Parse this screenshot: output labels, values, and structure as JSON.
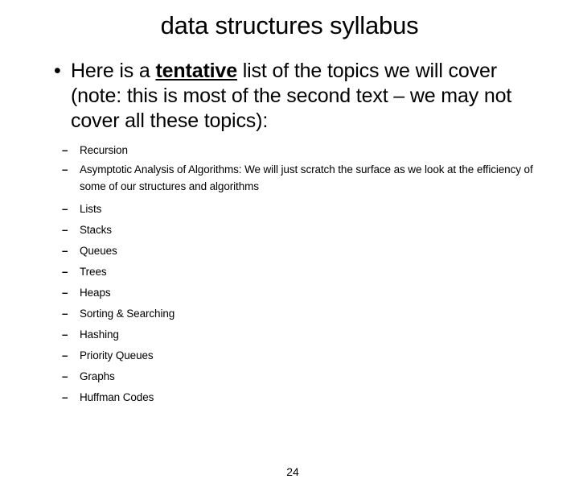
{
  "slide": {
    "title": "data structures syllabus",
    "page_number": "24",
    "bullet": {
      "marker": "•",
      "text_before_emphasis": "Here is a ",
      "emphasis": "tentative",
      "text_after_emphasis": " list of the topics we will cover (note: this is most of the second text – we may not cover all these topics):"
    },
    "sub_marker": "–",
    "topics": [
      {
        "label": "Recursion"
      },
      {
        "label": "Asymptotic Analysis of Algorithms: We will just scratch the surface as we look at the efficiency of some of our structures and algorithms"
      },
      {
        "label": "Lists"
      },
      {
        "label": "Stacks"
      },
      {
        "label": "Queues"
      },
      {
        "label": "Trees"
      },
      {
        "label": "Heaps"
      },
      {
        "label": "Sorting & Searching"
      },
      {
        "label": "Hashing"
      },
      {
        "label": "Priority Queues"
      },
      {
        "label": "Graphs"
      },
      {
        "label": "Huffman Codes"
      }
    ]
  }
}
